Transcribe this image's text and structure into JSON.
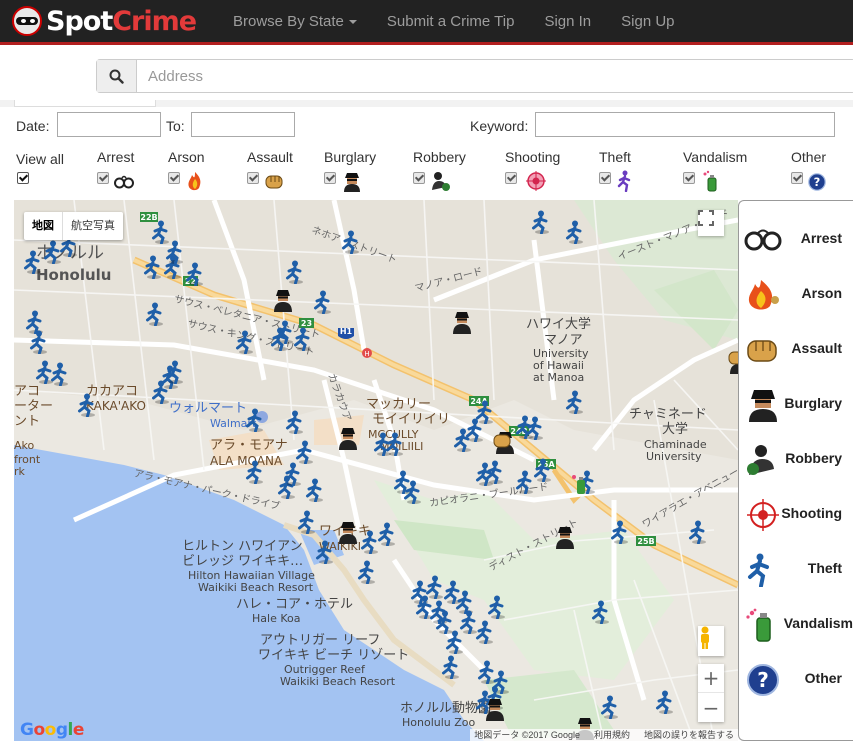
{
  "header": {
    "logo_spot": "Spot",
    "logo_crime": "Crime",
    "nav": [
      "Browse By State",
      "Submit a Crime Tip",
      "Sign In",
      "Sign Up"
    ]
  },
  "search": {
    "placeholder": "Address"
  },
  "filters": {
    "date_label": "Date:",
    "to_label": "To:",
    "keyword_label": "Keyword:",
    "categories": [
      "View all",
      "Arrest",
      "Arson",
      "Assault",
      "Burglary",
      "Robbery",
      "Shooting",
      "Theft",
      "Vandalism",
      "Other"
    ]
  },
  "map": {
    "map_type": [
      "地図",
      "航空写真"
    ],
    "zoom_in": "+",
    "zoom_out": "−",
    "google": [
      "G",
      "o",
      "o",
      "g",
      "l",
      "e"
    ],
    "attribution": [
      "地図データ ©2017 Google",
      "利用規約",
      "地図の誤りを報告する"
    ],
    "labels": [
      "ホノルル",
      "Honolulu",
      "カカアコ",
      "KAKA'AKO",
      "アラ・モアナ",
      "ALA MOANA",
      "ウォルマート",
      "Walmart",
      "マッカリー",
      "モイイリイリ",
      "MCCULLY",
      "MOILIILI",
      "ワイキキ",
      "WAIKIKI",
      "ハワイ大学",
      "マノア",
      "University",
      "of Hawaii",
      "at Manoa",
      "チャミネード",
      "大学",
      "Chaminade",
      "University",
      "ヒルトン ハワイアン",
      "ビレッジ ワイキキ…",
      "Hilton Hawaiian Village",
      "Waikiki Beach Resort",
      "ハレ・コア・ホテル",
      "Hale Koa",
      "アウトリガー リーフ",
      "ワイキキ ビーチ リゾート",
      "Outrigger Reef",
      "Waikiki Beach Resort",
      "ホノルル動物園",
      "Honolulu Zoo",
      "アラ・モアナ・パーク・ドライブ",
      "カピオラニ・ブールバード",
      "サウス・キング・ストリート",
      "サウス・ベレタニア・ストリート",
      "ワイアラエ・アベニュー",
      "H1",
      "22",
      "23",
      "24A",
      "24B",
      "25A",
      "25B",
      "アコ",
      "ーター",
      "ント",
      "Ako",
      "front",
      "rk",
      "マノア・ロード",
      "イースト・マノア・ロード",
      "ネホア・ストリート",
      "カラカウア",
      "ディスト・ストリート"
    ]
  },
  "legend": [
    "Arrest",
    "Arson",
    "Assault",
    "Burglary",
    "Robbery",
    "Shooting",
    "Theft",
    "Vandalism",
    "Other"
  ],
  "colors": {
    "accent": "#b21f1f",
    "navbar": "#222222",
    "theft": "#1f5fa8"
  }
}
